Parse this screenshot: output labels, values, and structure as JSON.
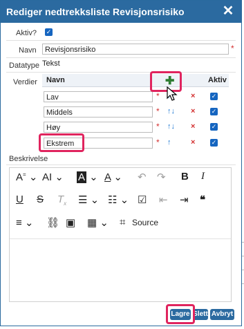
{
  "dialog": {
    "title": "Rediger nedtrekksliste Revisjonsrisiko",
    "close_icon": "close-icon"
  },
  "form": {
    "active_label": "Aktiv?",
    "active_checked": true,
    "name_label": "Navn",
    "name_value": "Revisjonsrisiko",
    "datatype_label": "Datatype",
    "datatype_value": "Tekst",
    "values_label": "Verdier",
    "required_mark": "*"
  },
  "values_table": {
    "headers": {
      "name": "Navn",
      "active": "Aktiv"
    },
    "add_icon": "plus-icon",
    "rows": [
      {
        "name": "Lav",
        "arrows": "↑↓",
        "delete": "×",
        "active": true
      },
      {
        "name": "Middels",
        "arrows": "↑↓",
        "delete": "×",
        "active": true
      },
      {
        "name": "Høy",
        "arrows": "↑↓",
        "delete": "×",
        "active": true
      },
      {
        "name": "Ekstrem",
        "arrows": "↑",
        "delete": "×",
        "active": true
      }
    ]
  },
  "description": {
    "label": "Beskrivelse",
    "toolbar": {
      "source_label": "Source",
      "row1": [
        "A⁼",
        "A𝐈",
        "A",
        "A",
        "↶",
        "↷",
        "B",
        "I"
      ],
      "row2": [
        "U",
        "S",
        "Tx",
        "≔",
        "≔",
        "☑",
        "⇤",
        "⇥",
        "❝"
      ],
      "row3": [
        "≡",
        "🔗",
        "🖼",
        "▦"
      ]
    }
  },
  "footer": {
    "save_label": "Lagre",
    "delete_label": "Slett",
    "cancel_label": "Avbryt"
  },
  "colors": {
    "brand": "#2b6aa0",
    "highlight": "#e0245e"
  }
}
